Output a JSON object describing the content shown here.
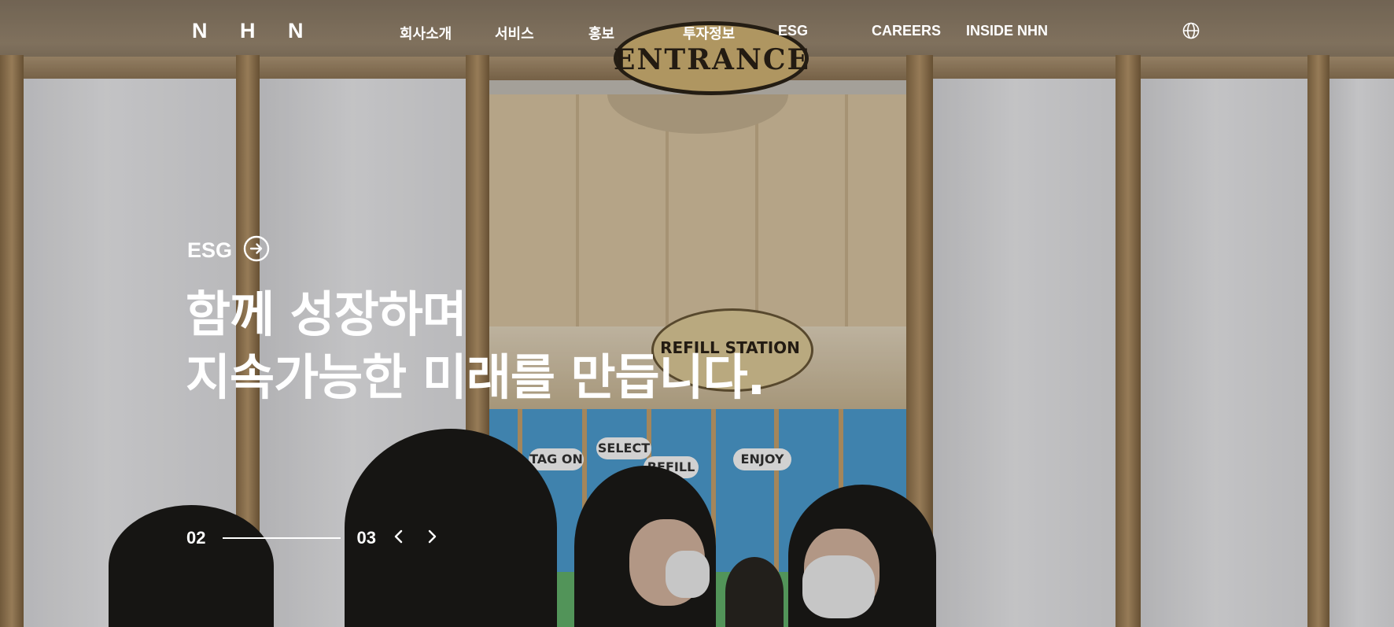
{
  "header": {
    "logo": "N H N",
    "nav": [
      {
        "label": "회사소개"
      },
      {
        "label": "서비스"
      },
      {
        "label": "홍보"
      },
      {
        "label": "투자정보"
      },
      {
        "label": "ESG"
      },
      {
        "label": "CAREERS"
      },
      {
        "label": "INSIDE NHN"
      }
    ],
    "language_icon": "globe-icon"
  },
  "hero": {
    "category": "ESG",
    "category_icon": "arrow-right-circle-icon",
    "title_line1": "함께 성장하며",
    "title_line2": "지속가능한 미래를 만듭니다."
  },
  "background_signs": {
    "entrance": "ENTRANCE",
    "refill_station": "REFILL STATION",
    "mural_clouds": [
      "TAG ON",
      "SELECT",
      "REFILL",
      "ENJOY"
    ]
  },
  "slider": {
    "current": "02",
    "total": "03",
    "progress_fraction": 1.0,
    "prev_icon": "chevron-left-icon",
    "next_icon": "chevron-right-icon"
  },
  "colors": {
    "text": "#ffffff",
    "wood": "#a88a62",
    "mural_blue": "#4d9fd3"
  }
}
